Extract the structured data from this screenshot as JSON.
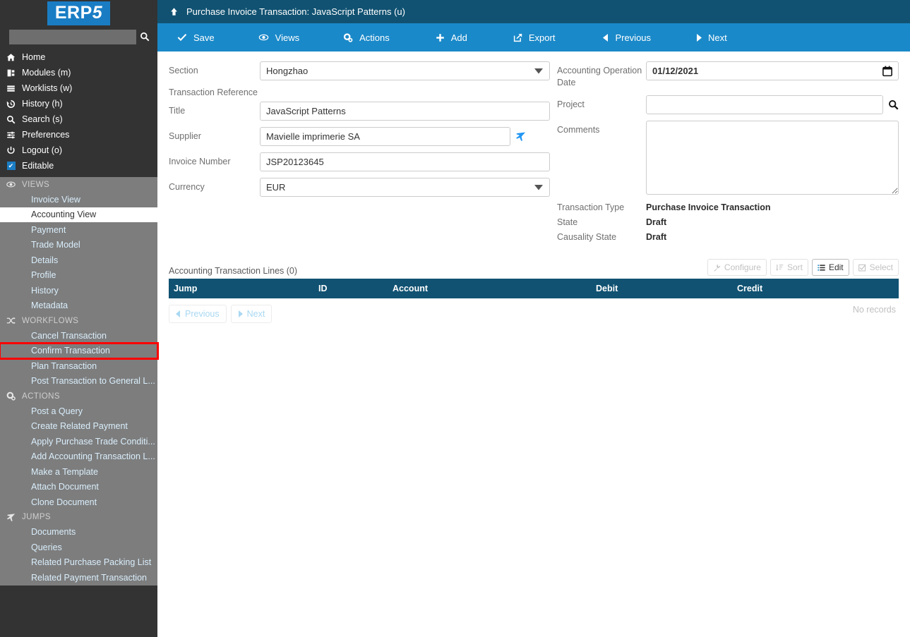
{
  "sidebar": {
    "logo": {
      "prefix": "ERP",
      "digit": "5"
    },
    "search": {
      "value": "",
      "placeholder": "",
      "icon": "search-icon"
    },
    "nav": [
      {
        "label": "Home",
        "icon": "home-icon"
      },
      {
        "label": "Modules (m)",
        "icon": "modules-icon"
      },
      {
        "label": "Worklists (w)",
        "icon": "worklists-icon"
      },
      {
        "label": "History (h)",
        "icon": "history-icon"
      },
      {
        "label": "Search (s)",
        "icon": "search-icon"
      },
      {
        "label": "Preferences",
        "icon": "sliders-icon"
      },
      {
        "label": "Logout (o)",
        "icon": "power-icon"
      },
      {
        "label": "Editable",
        "icon": "checkbox-checked-icon"
      }
    ],
    "groups": [
      {
        "title": "VIEWS",
        "icon": "eye-icon",
        "items": [
          {
            "label": "Invoice View",
            "state": "normal"
          },
          {
            "label": "Accounting View",
            "state": "active"
          },
          {
            "label": "Payment",
            "state": "normal"
          },
          {
            "label": "Trade Model",
            "state": "normal"
          },
          {
            "label": "Details",
            "state": "normal"
          },
          {
            "label": "Profile",
            "state": "normal"
          },
          {
            "label": "History",
            "state": "normal"
          },
          {
            "label": "Metadata",
            "state": "normal"
          }
        ]
      },
      {
        "title": "WORKFLOWS",
        "icon": "workflow-icon",
        "items": [
          {
            "label": "Cancel Transaction",
            "state": "normal"
          },
          {
            "label": "Confirm Transaction",
            "state": "highlighted"
          },
          {
            "label": "Plan Transaction",
            "state": "normal"
          },
          {
            "label": "Post Transaction to General L...",
            "state": "normal"
          }
        ]
      },
      {
        "title": "ACTIONS",
        "icon": "gear-icon",
        "items": [
          {
            "label": "Post a Query",
            "state": "normal"
          },
          {
            "label": "Create Related Payment",
            "state": "normal"
          },
          {
            "label": "Apply Purchase Trade Conditi...",
            "state": "normal"
          },
          {
            "label": "Add Accounting Transaction L...",
            "state": "normal"
          },
          {
            "label": "Make a Template",
            "state": "normal"
          },
          {
            "label": "Attach Document",
            "state": "normal"
          },
          {
            "label": "Clone Document",
            "state": "normal"
          }
        ]
      },
      {
        "title": "JUMPS",
        "icon": "plane-icon",
        "items": [
          {
            "label": "Documents",
            "state": "normal"
          },
          {
            "label": "Queries",
            "state": "normal"
          },
          {
            "label": "Related Purchase Packing List",
            "state": "normal"
          },
          {
            "label": "Related Payment Transaction",
            "state": "normal"
          }
        ]
      }
    ]
  },
  "header": {
    "title": "Purchase Invoice Transaction: JavaScript Patterns (u)",
    "up_icon": "arrow-up-icon"
  },
  "toolbar": [
    {
      "label": "Save",
      "icon": "check-icon"
    },
    {
      "label": "Views",
      "icon": "eye-icon"
    },
    {
      "label": "Actions",
      "icon": "gear-icon"
    },
    {
      "label": "Add",
      "icon": "plus-icon"
    },
    {
      "label": "Export",
      "icon": "export-icon"
    },
    {
      "label": "Previous",
      "icon": "caret-left-icon"
    },
    {
      "label": "Next",
      "icon": "caret-right-icon"
    }
  ],
  "form": {
    "section": {
      "label": "Section",
      "value": "Hongzhao"
    },
    "transaction_reference": {
      "label": "Transaction Reference"
    },
    "title": {
      "label": "Title",
      "value": "JavaScript Patterns"
    },
    "supplier": {
      "label": "Supplier",
      "value": "Mavielle imprimerie SA",
      "icon": "plane-icon"
    },
    "invoice_number": {
      "label": "Invoice Number",
      "value": "JSP20123645"
    },
    "currency": {
      "label": "Currency",
      "value": "EUR"
    },
    "accounting_operation_date": {
      "label": "Accounting Operation Date",
      "value": "01/12/2021",
      "icon": "calendar-icon"
    },
    "project": {
      "label": "Project",
      "value": "",
      "icon": "search-icon"
    },
    "comments": {
      "label": "Comments",
      "value": ""
    },
    "transaction_type": {
      "label": "Transaction Type",
      "value": "Purchase Invoice Transaction"
    },
    "state": {
      "label": "State",
      "value": "Draft"
    },
    "causality_state": {
      "label": "Causality State",
      "value": "Draft"
    }
  },
  "list": {
    "title": "Accounting Transaction Lines (0)",
    "buttons": [
      {
        "label": "Configure",
        "icon": "wrench-icon",
        "enabled": false
      },
      {
        "label": "Sort",
        "icon": "sort-icon",
        "enabled": false
      },
      {
        "label": "Edit",
        "icon": "list-icon",
        "enabled": true
      },
      {
        "label": "Select",
        "icon": "checkbox-icon",
        "enabled": false
      }
    ],
    "columns": [
      "Jump",
      "ID",
      "Account",
      "Debit",
      "Credit"
    ],
    "rows": [],
    "empty_text": "No records",
    "pager": [
      {
        "label": "Previous",
        "icon": "caret-left-icon"
      },
      {
        "label": "Next",
        "icon": "caret-right-icon"
      }
    ]
  },
  "colors": {
    "sidebar_dark": "#333333",
    "sidebar_grey": "#7d7d7d",
    "brand_blue": "#1a89c9",
    "title_blue": "#115272",
    "highlight_red": "#ff0000",
    "link_blue": "#d9eefc"
  }
}
